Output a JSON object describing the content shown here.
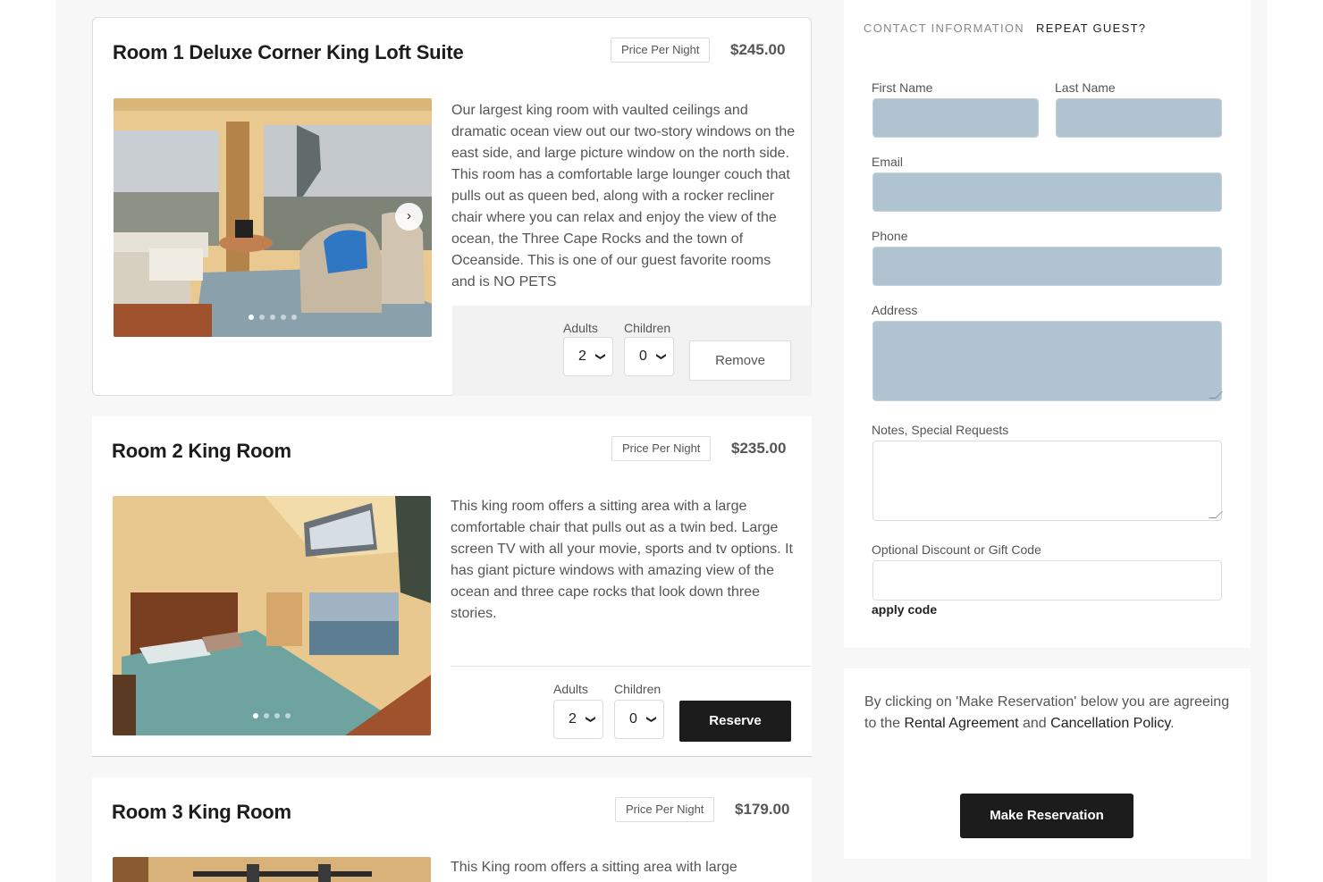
{
  "rooms": [
    {
      "title": "Room 1 Deluxe Corner King Loft Suite",
      "price_label": "Price Per Night",
      "price": "$245.00",
      "description": "Our largest king room with vaulted ceilings and dramatic ocean view out our two-story windows on the east side, and large picture window on the north side. This room has a comfortable large lounger couch that pulls out as queen bed, along with a rocker recliner chair where you can relax and enjoy the view of the ocean, the Three Cape Rocks and the town of Oceanside. This is one of our guest favorite rooms and is NO PETS",
      "adults_label": "Adults",
      "children_label": "Children",
      "adults": "2",
      "children": "0",
      "action": "Remove"
    },
    {
      "title": "Room 2 King Room",
      "price_label": "Price Per Night",
      "price": "$235.00",
      "description": "This king room offers a sitting area with a large comfortable chair that pulls out as a twin bed. Large screen TV with all your movie, sports and tv options. It has giant picture windows with amazing view of the ocean and three cape rocks that look down three stories.",
      "adults_label": "Adults",
      "children_label": "Children",
      "adults": "2",
      "children": "0",
      "action": "Reserve"
    },
    {
      "title": "Room 3 King Room",
      "price_label": "Price Per Night",
      "price": "$179.00",
      "description": "This King room offers a sitting area with large"
    }
  ],
  "form": {
    "tab_contact": "CONTACT INFORMATION",
    "tab_repeat": "REPEAT GUEST?",
    "first_name_label": "First Name",
    "last_name_label": "Last Name",
    "email_label": "Email",
    "phone_label": "Phone",
    "address_label": "Address",
    "notes_label": "Notes, Special Requests",
    "discount_label": "Optional Discount or Gift Code",
    "apply_code": "apply code"
  },
  "agreement": {
    "text_prefix": "By clicking on 'Make Reservation' below you are agreeing to the ",
    "rental_agreement": "Rental Agreement",
    "and": " and ",
    "cancellation_policy": "Cancellation Policy",
    "period": ".",
    "button": "Make Reservation"
  },
  "icons": {
    "next_arrow": "chevron-right-icon",
    "select_chevron": "chevron-down-icon"
  },
  "colors": {
    "input_fill": "#b0c3d0",
    "button_dark": "#1c1c1c"
  }
}
